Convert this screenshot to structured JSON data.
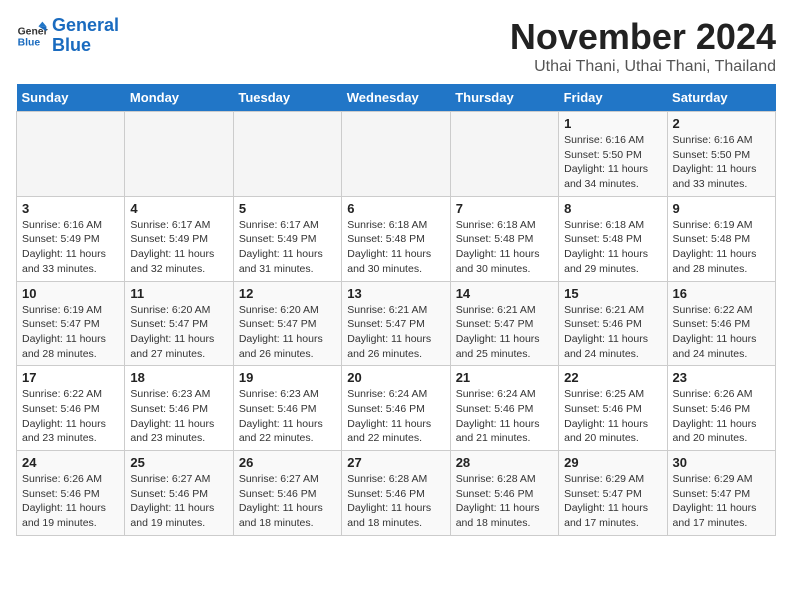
{
  "logo": {
    "line1": "General",
    "line2": "Blue"
  },
  "title": "November 2024",
  "subtitle": "Uthai Thani, Uthai Thani, Thailand",
  "days_of_week": [
    "Sunday",
    "Monday",
    "Tuesday",
    "Wednesday",
    "Thursday",
    "Friday",
    "Saturday"
  ],
  "weeks": [
    [
      {
        "day": "",
        "info": ""
      },
      {
        "day": "",
        "info": ""
      },
      {
        "day": "",
        "info": ""
      },
      {
        "day": "",
        "info": ""
      },
      {
        "day": "",
        "info": ""
      },
      {
        "day": "1",
        "info": "Sunrise: 6:16 AM\nSunset: 5:50 PM\nDaylight: 11 hours and 34 minutes."
      },
      {
        "day": "2",
        "info": "Sunrise: 6:16 AM\nSunset: 5:50 PM\nDaylight: 11 hours and 33 minutes."
      }
    ],
    [
      {
        "day": "3",
        "info": "Sunrise: 6:16 AM\nSunset: 5:49 PM\nDaylight: 11 hours and 33 minutes."
      },
      {
        "day": "4",
        "info": "Sunrise: 6:17 AM\nSunset: 5:49 PM\nDaylight: 11 hours and 32 minutes."
      },
      {
        "day": "5",
        "info": "Sunrise: 6:17 AM\nSunset: 5:49 PM\nDaylight: 11 hours and 31 minutes."
      },
      {
        "day": "6",
        "info": "Sunrise: 6:18 AM\nSunset: 5:48 PM\nDaylight: 11 hours and 30 minutes."
      },
      {
        "day": "7",
        "info": "Sunrise: 6:18 AM\nSunset: 5:48 PM\nDaylight: 11 hours and 30 minutes."
      },
      {
        "day": "8",
        "info": "Sunrise: 6:18 AM\nSunset: 5:48 PM\nDaylight: 11 hours and 29 minutes."
      },
      {
        "day": "9",
        "info": "Sunrise: 6:19 AM\nSunset: 5:48 PM\nDaylight: 11 hours and 28 minutes."
      }
    ],
    [
      {
        "day": "10",
        "info": "Sunrise: 6:19 AM\nSunset: 5:47 PM\nDaylight: 11 hours and 28 minutes."
      },
      {
        "day": "11",
        "info": "Sunrise: 6:20 AM\nSunset: 5:47 PM\nDaylight: 11 hours and 27 minutes."
      },
      {
        "day": "12",
        "info": "Sunrise: 6:20 AM\nSunset: 5:47 PM\nDaylight: 11 hours and 26 minutes."
      },
      {
        "day": "13",
        "info": "Sunrise: 6:21 AM\nSunset: 5:47 PM\nDaylight: 11 hours and 26 minutes."
      },
      {
        "day": "14",
        "info": "Sunrise: 6:21 AM\nSunset: 5:47 PM\nDaylight: 11 hours and 25 minutes."
      },
      {
        "day": "15",
        "info": "Sunrise: 6:21 AM\nSunset: 5:46 PM\nDaylight: 11 hours and 24 minutes."
      },
      {
        "day": "16",
        "info": "Sunrise: 6:22 AM\nSunset: 5:46 PM\nDaylight: 11 hours and 24 minutes."
      }
    ],
    [
      {
        "day": "17",
        "info": "Sunrise: 6:22 AM\nSunset: 5:46 PM\nDaylight: 11 hours and 23 minutes."
      },
      {
        "day": "18",
        "info": "Sunrise: 6:23 AM\nSunset: 5:46 PM\nDaylight: 11 hours and 23 minutes."
      },
      {
        "day": "19",
        "info": "Sunrise: 6:23 AM\nSunset: 5:46 PM\nDaylight: 11 hours and 22 minutes."
      },
      {
        "day": "20",
        "info": "Sunrise: 6:24 AM\nSunset: 5:46 PM\nDaylight: 11 hours and 22 minutes."
      },
      {
        "day": "21",
        "info": "Sunrise: 6:24 AM\nSunset: 5:46 PM\nDaylight: 11 hours and 21 minutes."
      },
      {
        "day": "22",
        "info": "Sunrise: 6:25 AM\nSunset: 5:46 PM\nDaylight: 11 hours and 20 minutes."
      },
      {
        "day": "23",
        "info": "Sunrise: 6:26 AM\nSunset: 5:46 PM\nDaylight: 11 hours and 20 minutes."
      }
    ],
    [
      {
        "day": "24",
        "info": "Sunrise: 6:26 AM\nSunset: 5:46 PM\nDaylight: 11 hours and 19 minutes."
      },
      {
        "day": "25",
        "info": "Sunrise: 6:27 AM\nSunset: 5:46 PM\nDaylight: 11 hours and 19 minutes."
      },
      {
        "day": "26",
        "info": "Sunrise: 6:27 AM\nSunset: 5:46 PM\nDaylight: 11 hours and 18 minutes."
      },
      {
        "day": "27",
        "info": "Sunrise: 6:28 AM\nSunset: 5:46 PM\nDaylight: 11 hours and 18 minutes."
      },
      {
        "day": "28",
        "info": "Sunrise: 6:28 AM\nSunset: 5:46 PM\nDaylight: 11 hours and 18 minutes."
      },
      {
        "day": "29",
        "info": "Sunrise: 6:29 AM\nSunset: 5:47 PM\nDaylight: 11 hours and 17 minutes."
      },
      {
        "day": "30",
        "info": "Sunrise: 6:29 AM\nSunset: 5:47 PM\nDaylight: 11 hours and 17 minutes."
      }
    ]
  ]
}
